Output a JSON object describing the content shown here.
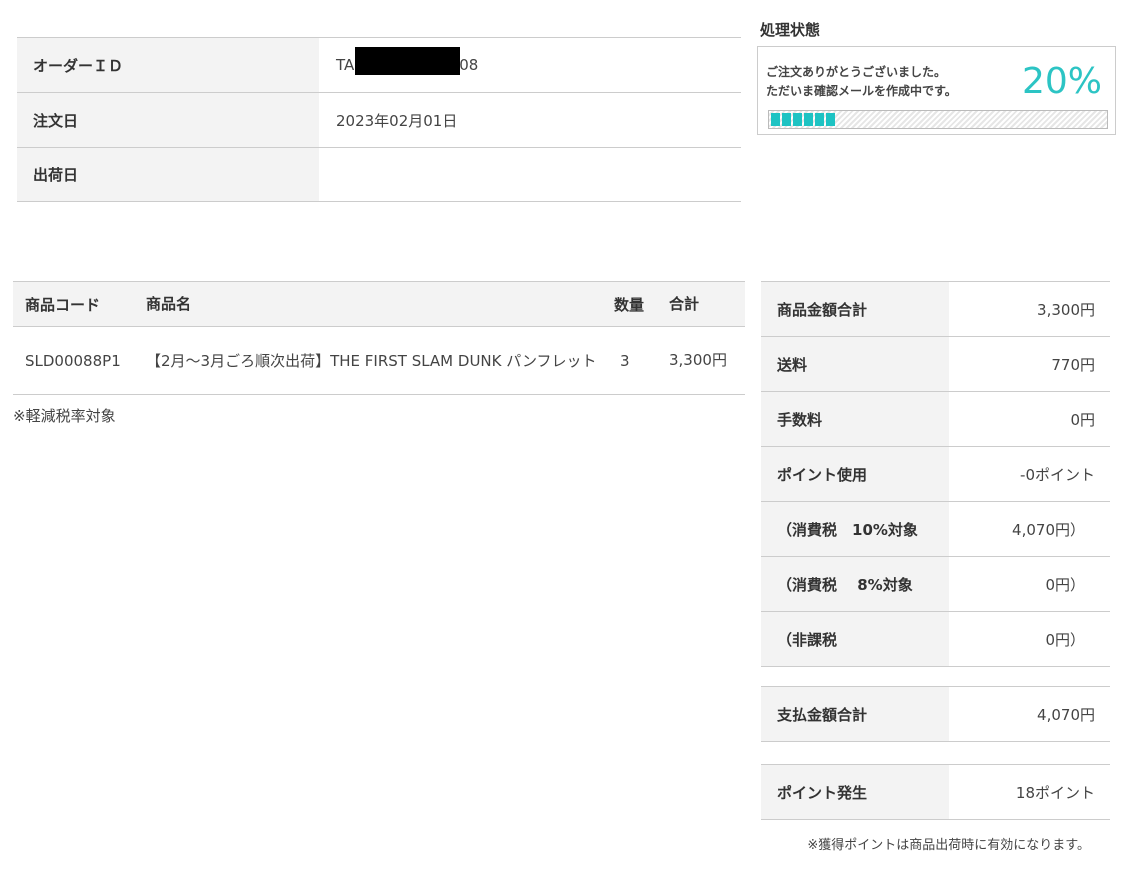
{
  "order_info": {
    "order_id_label": "オーダーＩＤ",
    "order_id_prefix": "TA",
    "order_id_suffix": "08",
    "order_date_label": "注文日",
    "order_date_value": "2023年02月01日",
    "ship_date_label": "出荷日",
    "ship_date_value": ""
  },
  "status": {
    "title": "処理状態",
    "message_line1": "ご注文ありがとうございました。",
    "message_line2": "ただいま確認メールを作成中です。",
    "percent_label": "20%",
    "progress": 0.2,
    "accent_color": "#1ec3c3"
  },
  "items": {
    "headers": {
      "code": "商品コード",
      "name": "商品名",
      "qty": "数量",
      "total": "合計"
    },
    "rows": [
      {
        "code": "SLD00088P1",
        "name": "【2月～3月ごろ順次出荷】THE FIRST SLAM DUNK パンフレット",
        "qty": "3",
        "total": "3,300円"
      }
    ],
    "tax_note": "※軽減税率対象"
  },
  "summary": {
    "subtotal_label": "商品金額合計",
    "subtotal_value": "3,300円",
    "shipping_label": "送料",
    "shipping_value": "770円",
    "fee_label": "手数料",
    "fee_value": "0円",
    "points_used_label": "ポイント使用",
    "points_used_value": "-0ポイント",
    "tax10_label": "（消費税　10%対象",
    "tax10_value": "4,070円）",
    "tax8_label": "（消費税　 8%対象",
    "tax8_value": "0円）",
    "nontax_label": "（非課税",
    "nontax_value": "0円）",
    "total_label": "支払金額合計",
    "total_value": "4,070円",
    "points_earned_label": "ポイント発生",
    "points_earned_value": "18ポイント",
    "points_note": "※獲得ポイントは商品出荷時に有効になります。"
  }
}
